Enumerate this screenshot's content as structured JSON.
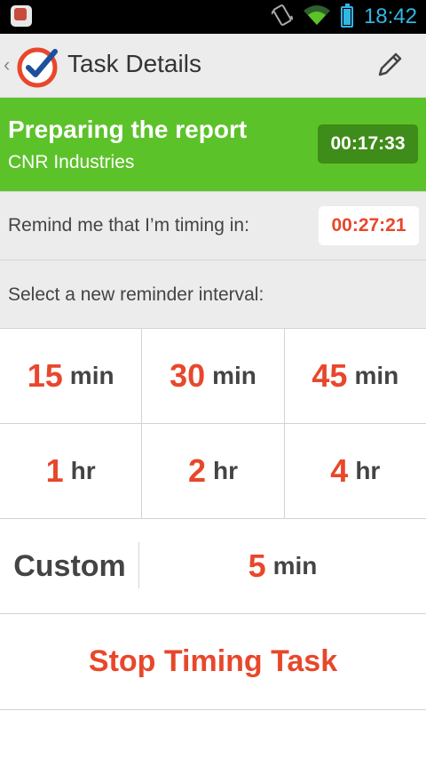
{
  "status_bar": {
    "time": "18:42",
    "icons": [
      "app-notification-icon",
      "vibrate-icon",
      "wifi-icon",
      "battery-icon"
    ]
  },
  "action_bar": {
    "title": "Task Details",
    "icons": [
      "up-chevron-icon",
      "app-logo-icon",
      "edit-pencil-icon"
    ]
  },
  "task": {
    "name": "Preparing the report",
    "client": "CNR Industries",
    "elapsed": "00:17:33"
  },
  "reminder": {
    "label": "Remind me that I’m timing in:",
    "remaining": "00:27:21"
  },
  "select_label": "Select a new reminder interval:",
  "intervals": [
    {
      "value": "15",
      "unit": "min"
    },
    {
      "value": "30",
      "unit": "min"
    },
    {
      "value": "45",
      "unit": "min"
    },
    {
      "value": "1",
      "unit": "hr"
    },
    {
      "value": "2",
      "unit": "hr"
    },
    {
      "value": "4",
      "unit": "hr"
    }
  ],
  "custom": {
    "label": "Custom",
    "value": "5",
    "unit": "min"
  },
  "stop_label": "Stop Timing Task",
  "colors": {
    "accent_red": "#e8472b",
    "task_green": "#5cc22a",
    "timer_dark_green": "#3e8c19",
    "status_blue": "#33b5e5"
  }
}
